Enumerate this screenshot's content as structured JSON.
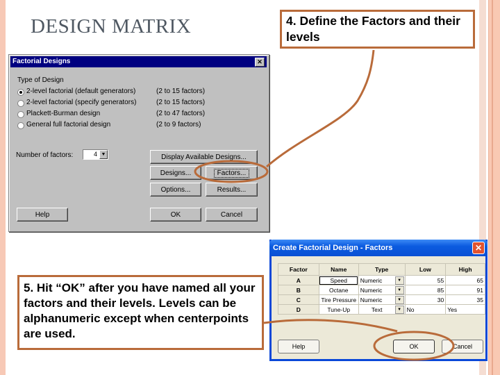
{
  "slide": {
    "title": "DESIGN MATRIX",
    "accent_color": "#b96b3a"
  },
  "callouts": {
    "step4": "4.  Define the Factors and their levels",
    "step5": "5. Hit “OK” after you have named all your factors and their levels.  Levels can be alphanumeric except when centerpoints are used."
  },
  "factorial_dialog": {
    "title": "Factorial Designs",
    "close_icon": "close-icon",
    "group_label": "Type of Design",
    "options": [
      {
        "label": "2-level factorial (default generators)",
        "range": "(2 to 15 factors)",
        "checked": true
      },
      {
        "label": "2-level factorial (specify generators)",
        "range": "(2 to 15 factors)",
        "checked": false
      },
      {
        "label": "Plackett-Burman design",
        "range": "(2 to 47 factors)",
        "checked": false
      },
      {
        "label": "General full factorial design",
        "range": "(2 to 9 factors)",
        "checked": false
      }
    ],
    "num_factors_label": "Number of factors:",
    "num_factors_value": "4",
    "buttons": {
      "display": "Display Available Designs...",
      "designs": "Designs...",
      "factors": "Factors...",
      "options": "Options...",
      "results": "Results...",
      "help": "Help",
      "ok": "OK",
      "cancel": "Cancel"
    }
  },
  "factors_dialog": {
    "title": "Create Factorial Design - Factors",
    "close_icon": "close-icon",
    "columns": [
      "Factor",
      "Name",
      "Type",
      "Low",
      "High"
    ],
    "rows": [
      {
        "factor": "A",
        "name": "Speed",
        "type": "Numeric",
        "low": "55",
        "high": "65"
      },
      {
        "factor": "B",
        "name": "Octane",
        "type": "Numeric",
        "low": "85",
        "high": "91"
      },
      {
        "factor": "C",
        "name": "Tire Pressure",
        "type": "Numeric",
        "low": "30",
        "high": "35"
      },
      {
        "factor": "D",
        "name": "Tune-Up",
        "type": "Text",
        "low": "No",
        "high": "Yes"
      }
    ],
    "buttons": {
      "help": "Help",
      "ok": "OK",
      "cancel": "Cancel"
    }
  }
}
